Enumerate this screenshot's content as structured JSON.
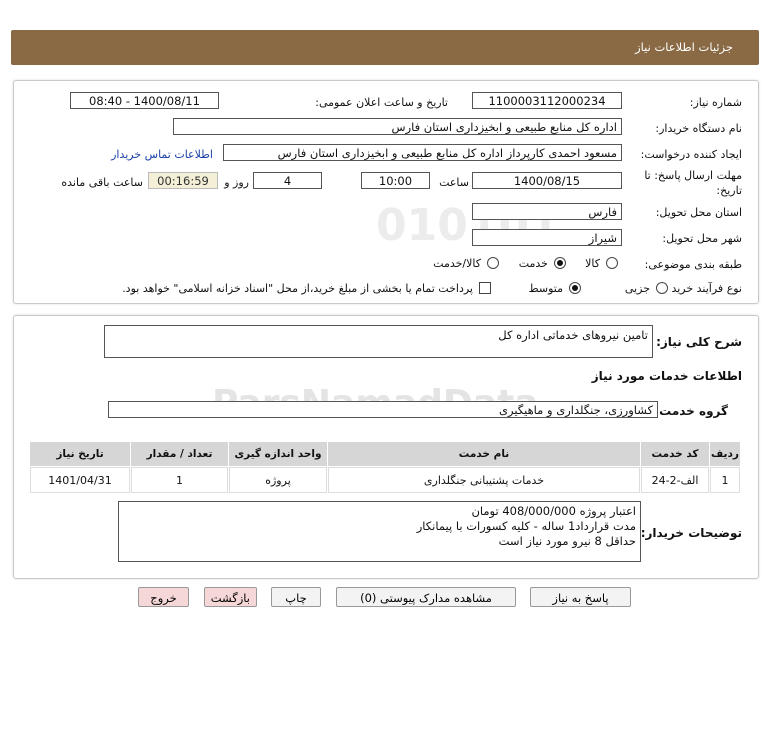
{
  "header": {
    "title": "جزئیات اطلاعات نیاز"
  },
  "form": {
    "need_number_label": "شماره نیاز:",
    "need_number": "1100003112000234",
    "announce_label": "تاریخ و ساعت اعلان عمومی:",
    "announce_value": "1400/08/11 - 08:40",
    "buyer_org_label": "نام دستگاه خریدار:",
    "buyer_org": "اداره کل منابع طبیعی و ابخیزداری استان فارس",
    "requester_label": "ایجاد کننده درخواست:",
    "requester": "مسعود احمدی کارپرداز اداره کل منابع طبیعی و ابخیزداری استان فارس",
    "contact_link": "اطلاعات تماس خریدار",
    "deadline_label": "مهلت ارسال پاسخ: تا تاریخ:",
    "deadline_date": "1400/08/15",
    "time_label": "ساعت",
    "deadline_time": "10:00",
    "days_value": "4",
    "days_label": "روز و",
    "remaining_time": "00:16:59",
    "remaining_label": "ساعت باقی مانده",
    "province_label": "استان محل تحویل:",
    "province": "فارس",
    "city_label": "شهر محل تحویل:",
    "city": "شیراز",
    "category_label": "طبقه بندی موضوعی:",
    "category_options": [
      "کالا",
      "خدمت",
      "کالا/خدمت"
    ],
    "category_selected": "خدمت",
    "process_label": "نوع فرآیند خرید :",
    "process_options": [
      "جزیی",
      "متوسط"
    ],
    "process_selected": "متوسط",
    "payment_note": "پرداخت تمام یا بخشی از مبلغ خرید،از محل \"اسناد خزانه اسلامی\" خواهد بود."
  },
  "details": {
    "summary_label": "شرح کلی نیاز:",
    "summary": "تامین نیروهای خدماتی اداره کل",
    "services_title": "اطلاعات خدمات مورد نیاز",
    "service_group_label": "گروه خدمت:",
    "service_group": "کشاورزی، جنگلداری و ماهیگیری",
    "table": {
      "headers": [
        "ردیف",
        "کد خدمت",
        "نام خدمت",
        "واحد اندازه گیری",
        "تعداد / مقدار",
        "تاریخ نیاز"
      ],
      "rows": [
        [
          "1",
          "الف-2-24",
          "خدمات پشتیبانی جنگلداری",
          "پروژه",
          "1",
          "1401/04/31"
        ]
      ]
    },
    "buyer_notes_label": "توضیحات خریدار:",
    "buyer_notes": [
      "اعتبار پروژه 408/000/000 تومان",
      "مدت قرارداد1 ساله - کلیه کسورات با پیمانکار",
      "حداقل 8 نیرو مورد نیاز است"
    ]
  },
  "buttons": {
    "reply": "پاسخ به نیاز",
    "attachments": "مشاهده مدارک پیوستی (0)",
    "print": "چاپ",
    "back": "بازگشت",
    "exit": "خروج"
  },
  "watermark": {
    "text": "ParsNamadData",
    "phone": "۰۲۱-۸۸۳۴۹۶۷۰"
  }
}
